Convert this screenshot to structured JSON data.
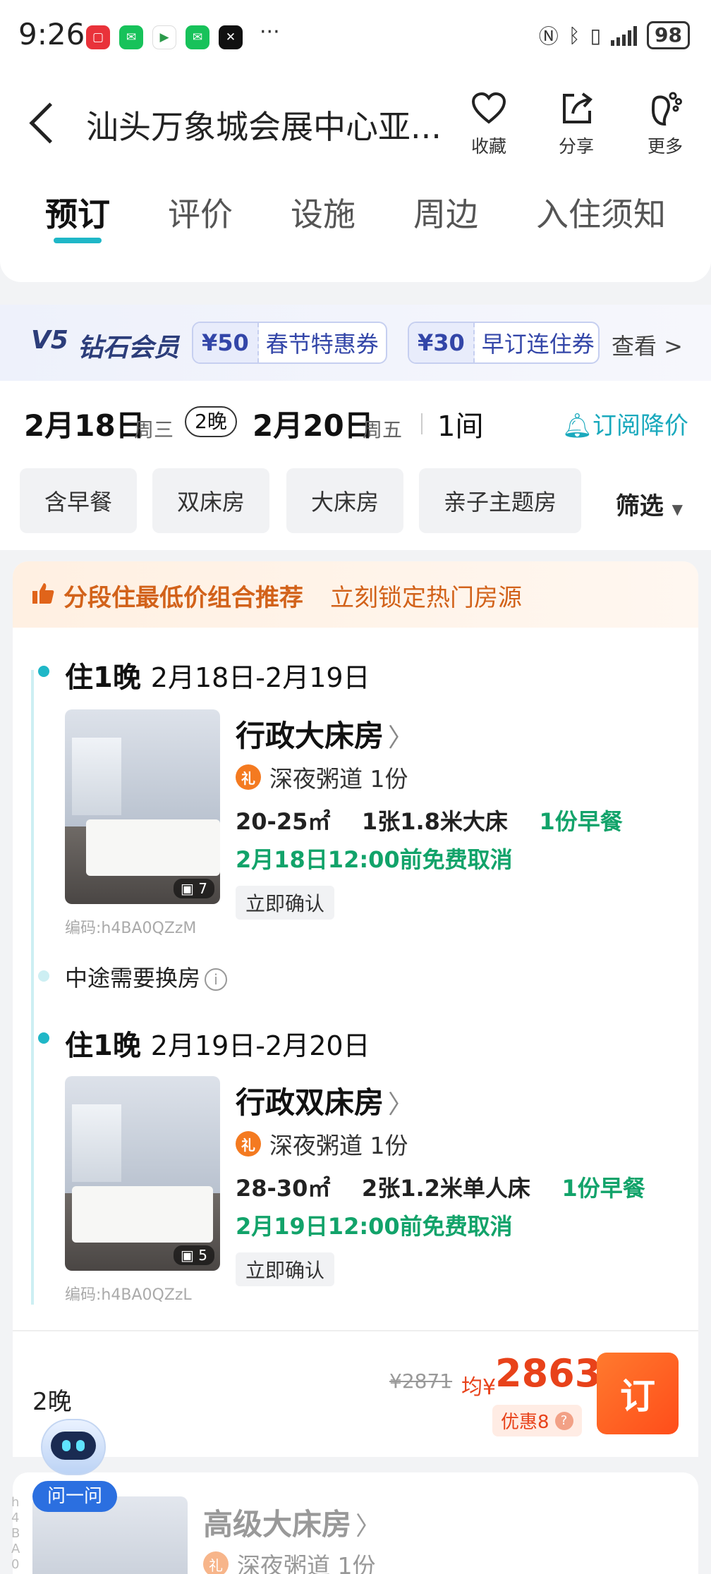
{
  "status_bar": {
    "time": "9:26",
    "battery": "98",
    "more": "···"
  },
  "header": {
    "title": "汕头万象城会展中心亚...",
    "actions": [
      {
        "label": "收藏",
        "icon": "heart-icon"
      },
      {
        "label": "分享",
        "icon": "share-icon"
      },
      {
        "label": "更多",
        "icon": "footprint-icon"
      }
    ]
  },
  "tabs": [
    "预订",
    "评价",
    "设施",
    "周边",
    "入住须知"
  ],
  "member": {
    "level": "V5",
    "title": "钻石会员",
    "coupons": [
      {
        "amount": "¥50",
        "name": "春节特惠券"
      },
      {
        "amount": "¥30",
        "name": "早订连住券"
      }
    ],
    "view_more": "查看 >"
  },
  "dates": {
    "checkin": "2月18日",
    "checkin_weekday": "周三",
    "nights": "2晚",
    "checkout": "2月20日",
    "checkout_weekday": "周五",
    "rooms": "1间",
    "subscribe": "订阅降价"
  },
  "filters": {
    "chips": [
      "含早餐",
      "双床房",
      "大床房",
      "亲子主题房"
    ],
    "filter_label": "筛选"
  },
  "combo": {
    "banner_title": "分段住最低价组合推荐",
    "banner_sub": "立刻锁定热门房源",
    "mid_change": "中途需要换房",
    "segments": [
      {
        "stay": "住1晚",
        "range": "2月18日-2月19日",
        "room_name": "行政大床房",
        "gift": "深夜粥道 1份",
        "area": "20-25㎡",
        "bed": "1张1.8米大床",
        "breakfast": "1份早餐",
        "cancel": "2月18日12:00前免费取消",
        "confirm": "立即确认",
        "photo_count": "7",
        "code": "编码:h4BA0QZzM"
      },
      {
        "stay": "住1晚",
        "range": "2月19日-2月20日",
        "room_name": "行政双床房",
        "gift": "深夜粥道 1份",
        "area": "28-30㎡",
        "bed": "2张1.2米单人床",
        "breakfast": "1份早餐",
        "cancel": "2月19日12:00前免费取消",
        "confirm": "立即确认",
        "photo_count": "5",
        "code": "编码:h4BA0QZzL"
      }
    ],
    "price": {
      "nights": "2晚",
      "original": "¥2871",
      "avg_label": "均¥",
      "price": "2863",
      "discount": "优惠8",
      "book": "订"
    }
  },
  "assistant": {
    "label": "问一问"
  },
  "next_room": {
    "name": "高级大床房",
    "gift": "深夜粥道 1份",
    "side_code": "h4BA0"
  },
  "colors": {
    "accent": "#1fb7c7",
    "price": "#e8421a",
    "green": "#12a36a",
    "orange": "#d2621a"
  }
}
